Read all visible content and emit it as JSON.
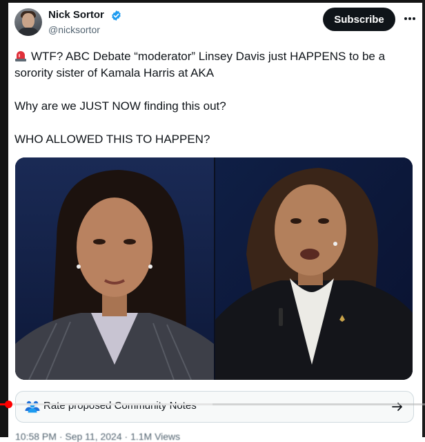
{
  "author": {
    "display_name": "Nick Sortor",
    "handle": "@nicksortor",
    "verified": true
  },
  "actions": {
    "subscribe_label": "Subscribe",
    "more_icon": "ellipsis-icon"
  },
  "tweet": {
    "line1": "WTF? ABC Debate “moderator” Linsey Davis just HAPPENS to be a sorority sister of Kamala Harris at AKA",
    "line2": "Why are we JUST NOW finding this out?",
    "line3": "WHO ALLOWED THIS TO HAPPEN?",
    "leading_icon": "siren-emoji"
  },
  "community_notes": {
    "label": "Rate proposed Community Notes",
    "icon": "people-icon",
    "arrow_icon": "arrow-right-icon"
  },
  "video_player": {
    "progress_fraction": 0.02,
    "buffered_fraction": 0.5,
    "played_color": "#ff0000"
  },
  "timestamp": "10:58 PM · Sep 11, 2024 · 1.1M Views",
  "colors": {
    "verified_blue": "#1d9bf0",
    "text_primary": "#0f1419",
    "text_secondary": "#536471"
  }
}
